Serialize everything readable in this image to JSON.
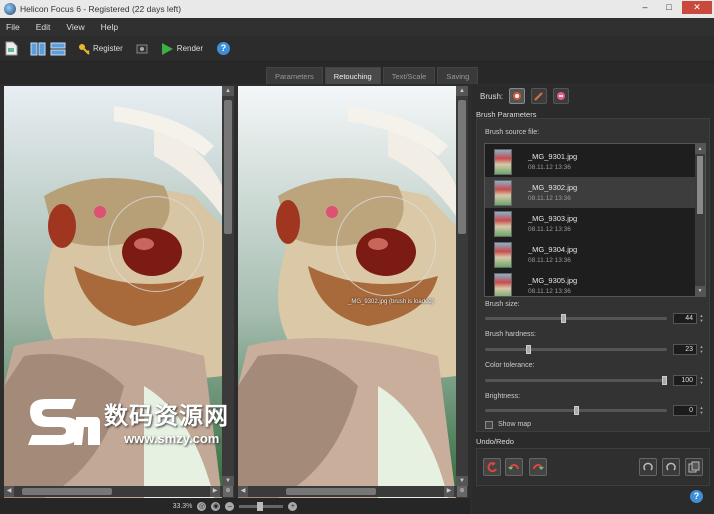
{
  "window": {
    "title": "Helicon Focus 6 - Registered (22 days left)"
  },
  "menu": [
    "File",
    "Edit",
    "View",
    "Help"
  ],
  "toolbar": {
    "register_label": "Register",
    "render_label": "Render"
  },
  "tabs": [
    {
      "label": "Parameters",
      "active": false
    },
    {
      "label": "Retouching",
      "active": true
    },
    {
      "label": "Text/Scale",
      "active": false
    },
    {
      "label": "Saving",
      "active": false
    }
  ],
  "preview": {
    "overlay_text": "_MG_9302.jpg (brush is loaded)"
  },
  "statusbar": {
    "zoom": "33.3%"
  },
  "brush": {
    "label": "Brush:",
    "parameters_title": "Brush Parameters",
    "source_label": "Brush source file:",
    "files": [
      {
        "name": "_MG_9301.jpg",
        "date": "08.11.12 13:36",
        "selected": false
      },
      {
        "name": "_MG_9302.jpg",
        "date": "08.11.12 13:36",
        "selected": true
      },
      {
        "name": "_MG_9303.jpg",
        "date": "08.11.12 13:36",
        "selected": false
      },
      {
        "name": "_MG_9304.jpg",
        "date": "08.11.12 13:36",
        "selected": false
      },
      {
        "name": "_MG_9305.jpg",
        "date": "08.11.12 13:36",
        "selected": false
      }
    ],
    "params": [
      {
        "label": "Brush size:",
        "value": "44",
        "level": 0.43
      },
      {
        "label": "Brush hardness:",
        "value": "23",
        "level": 0.23
      },
      {
        "label": "Color tolerance:",
        "value": "100",
        "level": 1.0
      },
      {
        "label": "Brightness:",
        "value": "0",
        "level": 0.5
      }
    ],
    "show_map_label": "Show map"
  },
  "undo": {
    "title": "Undo/Redo"
  },
  "watermark": {
    "cn": "数码资源网",
    "url": "www.smzy.com"
  },
  "colors": {
    "accent": "#3d8fd8",
    "render_green": "#3cb043",
    "background": "#2d2d2d"
  }
}
